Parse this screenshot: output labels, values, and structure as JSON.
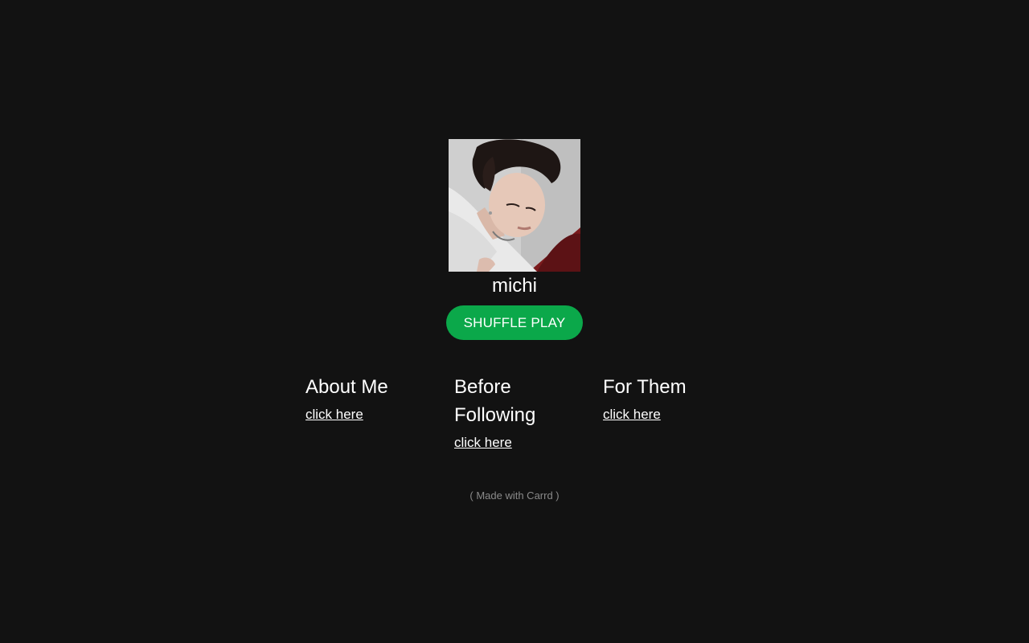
{
  "profile": {
    "photo": "profile-photo",
    "username": "michi"
  },
  "actions": {
    "shuffle_label": "SHUFFLE PLAY",
    "shuffle_color": "#0ba84a"
  },
  "sections": [
    {
      "heading": "About Me",
      "link": "click here"
    },
    {
      "heading": "Before Following",
      "link": "click here"
    },
    {
      "heading": "For Them",
      "link": "click here"
    }
  ],
  "footer": {
    "credit": "( Made with Carrd )"
  },
  "colors": {
    "background": "#121212",
    "text": "#ffffff",
    "muted": "#8a8a8a"
  }
}
